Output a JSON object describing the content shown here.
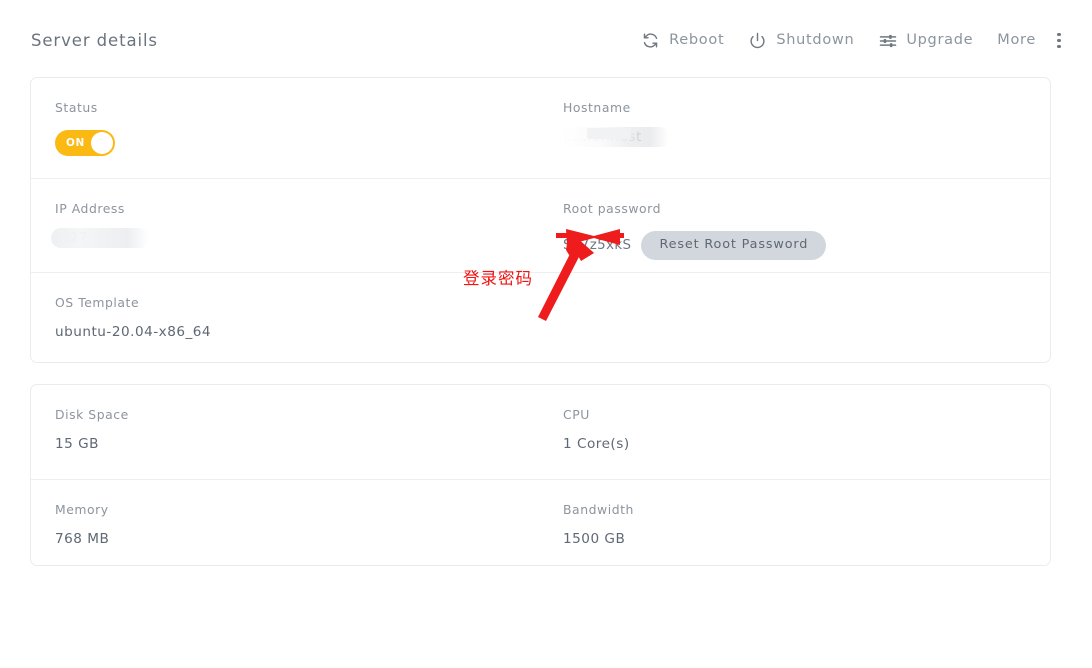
{
  "header": {
    "title": "Server details",
    "actions": [
      {
        "label": "Reboot",
        "icon": "refresh-icon"
      },
      {
        "label": "Shutdown",
        "icon": "power-icon"
      },
      {
        "label": "Upgrade",
        "icon": "sliders-icon"
      },
      {
        "label": "More",
        "icon": "more-vertical-icon"
      }
    ]
  },
  "cards": {
    "main": {
      "status": {
        "label": "Status",
        "toggle_text": "ON",
        "toggle_state": "on",
        "toggle_color": "#fbb913"
      },
      "hostname": {
        "label": "Hostname",
        "value": "......er.host",
        "redacted": true
      },
      "ip_address": {
        "label": "IP Address",
        "value": "...27",
        "redacted": true
      },
      "root_password": {
        "label": "Root password",
        "value": "Sp7z5xkS",
        "reset_button": "Reset Root Password"
      },
      "os_template": {
        "label": "OS Template",
        "value": "ubuntu-20.04-x86_64"
      }
    },
    "specs": {
      "disk_space": {
        "label": "Disk Space",
        "value": "15 GB"
      },
      "cpu": {
        "label": "CPU",
        "value": "1 Core(s)"
      },
      "memory": {
        "label": "Memory",
        "value": "768 MB"
      },
      "bandwidth": {
        "label": "Bandwidth",
        "value": "1500 GB"
      }
    }
  },
  "annotation": {
    "text": "登录密码",
    "color": "#f01414"
  }
}
